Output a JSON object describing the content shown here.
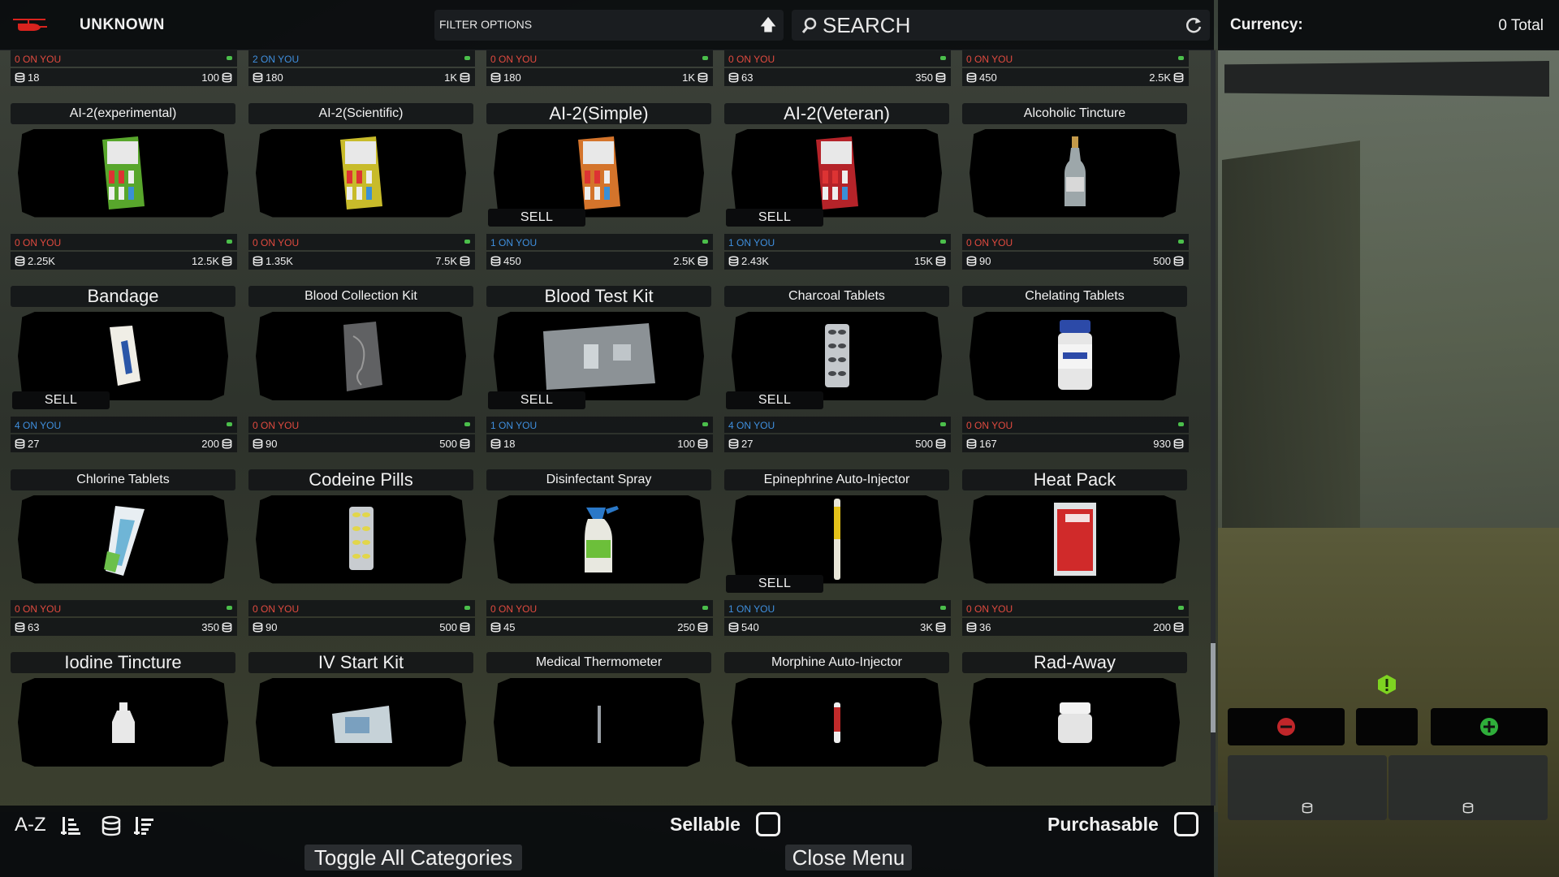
{
  "header": {
    "trader_name": "UNKNOWN",
    "filter_label": "FILTER OPTIONS",
    "search_placeholder": "SEARCH"
  },
  "currency": {
    "label": "Currency:",
    "total": "0 Total"
  },
  "items": [
    {
      "name": "",
      "on_you": "0 ON YOU",
      "sell": "18",
      "buy": "100",
      "sellable": false,
      "img": "thermometer-loop"
    },
    {
      "name": "",
      "on_you": "2 ON YOU",
      "sell": "180",
      "buy": "1K",
      "sellable": true,
      "img": "pouch"
    },
    {
      "name": "",
      "on_you": "0 ON YOU",
      "sell": "180",
      "buy": "1K",
      "sellable": false,
      "img": "pills-red"
    },
    {
      "name": "",
      "on_you": "0 ON YOU",
      "sell": "63",
      "buy": "350",
      "sellable": false,
      "img": "tube"
    },
    {
      "name": "",
      "on_you": "0 ON YOU",
      "sell": "450",
      "buy": "2.5K",
      "sellable": false,
      "img": "kit-blue"
    },
    {
      "name": "AI-2(experimental)",
      "on_you": "0 ON YOU",
      "sell": "2.25K",
      "buy": "12.5K",
      "sellable": false,
      "img": "kit-green"
    },
    {
      "name": "AI-2(Scientific)",
      "on_you": "0 ON YOU",
      "sell": "1.35K",
      "buy": "7.5K",
      "sellable": false,
      "img": "kit-yellow"
    },
    {
      "name": "AI-2(Simple)",
      "on_you": "1 ON YOU",
      "sell": "450",
      "buy": "2.5K",
      "sellable": true,
      "img": "kit-orange",
      "big": true
    },
    {
      "name": "AI-2(Veteran)",
      "on_you": "1 ON YOU",
      "sell": "2.43K",
      "buy": "15K",
      "sellable": true,
      "img": "kit-red",
      "big": true
    },
    {
      "name": "Alcoholic Tincture",
      "on_you": "0 ON YOU",
      "sell": "90",
      "buy": "500",
      "sellable": false,
      "img": "bottle"
    },
    {
      "name": "Bandage",
      "on_you": "4 ON YOU",
      "sell": "27",
      "buy": "200",
      "sellable": true,
      "img": "bandage",
      "big": true
    },
    {
      "name": "Blood Collection Kit",
      "on_you": "0 ON YOU",
      "sell": "90",
      "buy": "500",
      "sellable": false,
      "img": "bag"
    },
    {
      "name": "Blood Test Kit",
      "on_you": "1 ON YOU",
      "sell": "18",
      "buy": "100",
      "sellable": true,
      "img": "testkit",
      "big": true
    },
    {
      "name": "Charcoal Tablets",
      "on_you": "4 ON YOU",
      "sell": "27",
      "buy": "500",
      "sellable": true,
      "img": "pills-grey"
    },
    {
      "name": "Chelating Tablets",
      "on_you": "0 ON YOU",
      "sell": "167",
      "buy": "930",
      "sellable": false,
      "img": "jar-blue"
    },
    {
      "name": "Chlorine Tablets",
      "on_you": "0 ON YOU",
      "sell": "63",
      "buy": "350",
      "sellable": false,
      "img": "packet"
    },
    {
      "name": "Codeine Pills",
      "on_you": "0 ON YOU",
      "sell": "90",
      "buy": "500",
      "sellable": false,
      "img": "pills-yellow",
      "big": true
    },
    {
      "name": "Disinfectant Spray",
      "on_you": "0 ON YOU",
      "sell": "45",
      "buy": "250",
      "sellable": false,
      "img": "spray"
    },
    {
      "name": "Epinephrine Auto-Injector",
      "on_you": "1 ON YOU",
      "sell": "540",
      "buy": "3K",
      "sellable": true,
      "img": "injector-yellow"
    },
    {
      "name": "Heat Pack",
      "on_you": "0 ON YOU",
      "sell": "36",
      "buy": "200",
      "sellable": false,
      "img": "heatpack",
      "big": true
    },
    {
      "name": "Iodine Tincture",
      "on_you": "",
      "sell": "",
      "buy": "",
      "sellable": false,
      "img": "bottle-small",
      "big": true
    },
    {
      "name": "IV Start Kit",
      "on_you": "",
      "sell": "",
      "buy": "",
      "sellable": false,
      "img": "ivkit",
      "big": true
    },
    {
      "name": "Medical Thermometer",
      "on_you": "",
      "sell": "",
      "buy": "",
      "sellable": false,
      "img": "stick"
    },
    {
      "name": "Morphine Auto-Injector",
      "on_you": "",
      "sell": "",
      "buy": "",
      "sellable": false,
      "img": "injector-red"
    },
    {
      "name": "Rad-Away",
      "on_you": "",
      "sell": "",
      "buy": "",
      "sellable": false,
      "img": "jar-white",
      "big": true
    }
  ],
  "sell_label": "SELL",
  "footer": {
    "sort_az": "A-Z",
    "sellable_label": "Sellable",
    "purchasable_label": "Purchasable",
    "toggle_label": "Toggle All Categories",
    "close_label": "Close Menu"
  },
  "colors": {
    "on_you_zero": "#e04a3f",
    "on_you_have": "#3f8fde",
    "plus": "#2fae3a",
    "minus": "#c0262a",
    "alert": "#7ed321"
  }
}
